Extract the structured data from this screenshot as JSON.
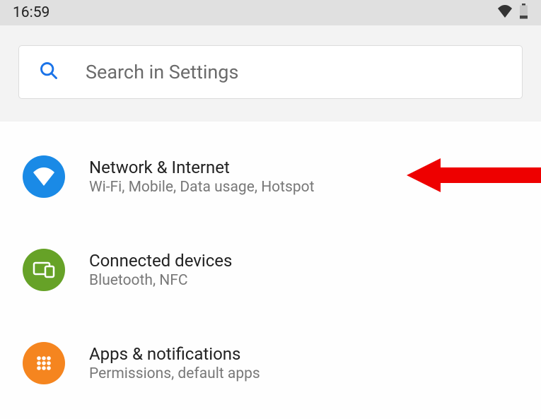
{
  "status_bar": {
    "time": "16:59"
  },
  "search": {
    "placeholder": "Search in Settings"
  },
  "settings": {
    "items": [
      {
        "title": "Network & Internet",
        "subtitle": "Wi-Fi, Mobile, Data usage, Hotspot",
        "icon": "wifi",
        "color": "blue"
      },
      {
        "title": "Connected devices",
        "subtitle": "Bluetooth, NFC",
        "icon": "devices",
        "color": "green"
      },
      {
        "title": "Apps & notifications",
        "subtitle": "Permissions, default apps",
        "icon": "apps",
        "color": "orange"
      }
    ]
  },
  "annotation": {
    "arrow_target_index": 0
  }
}
